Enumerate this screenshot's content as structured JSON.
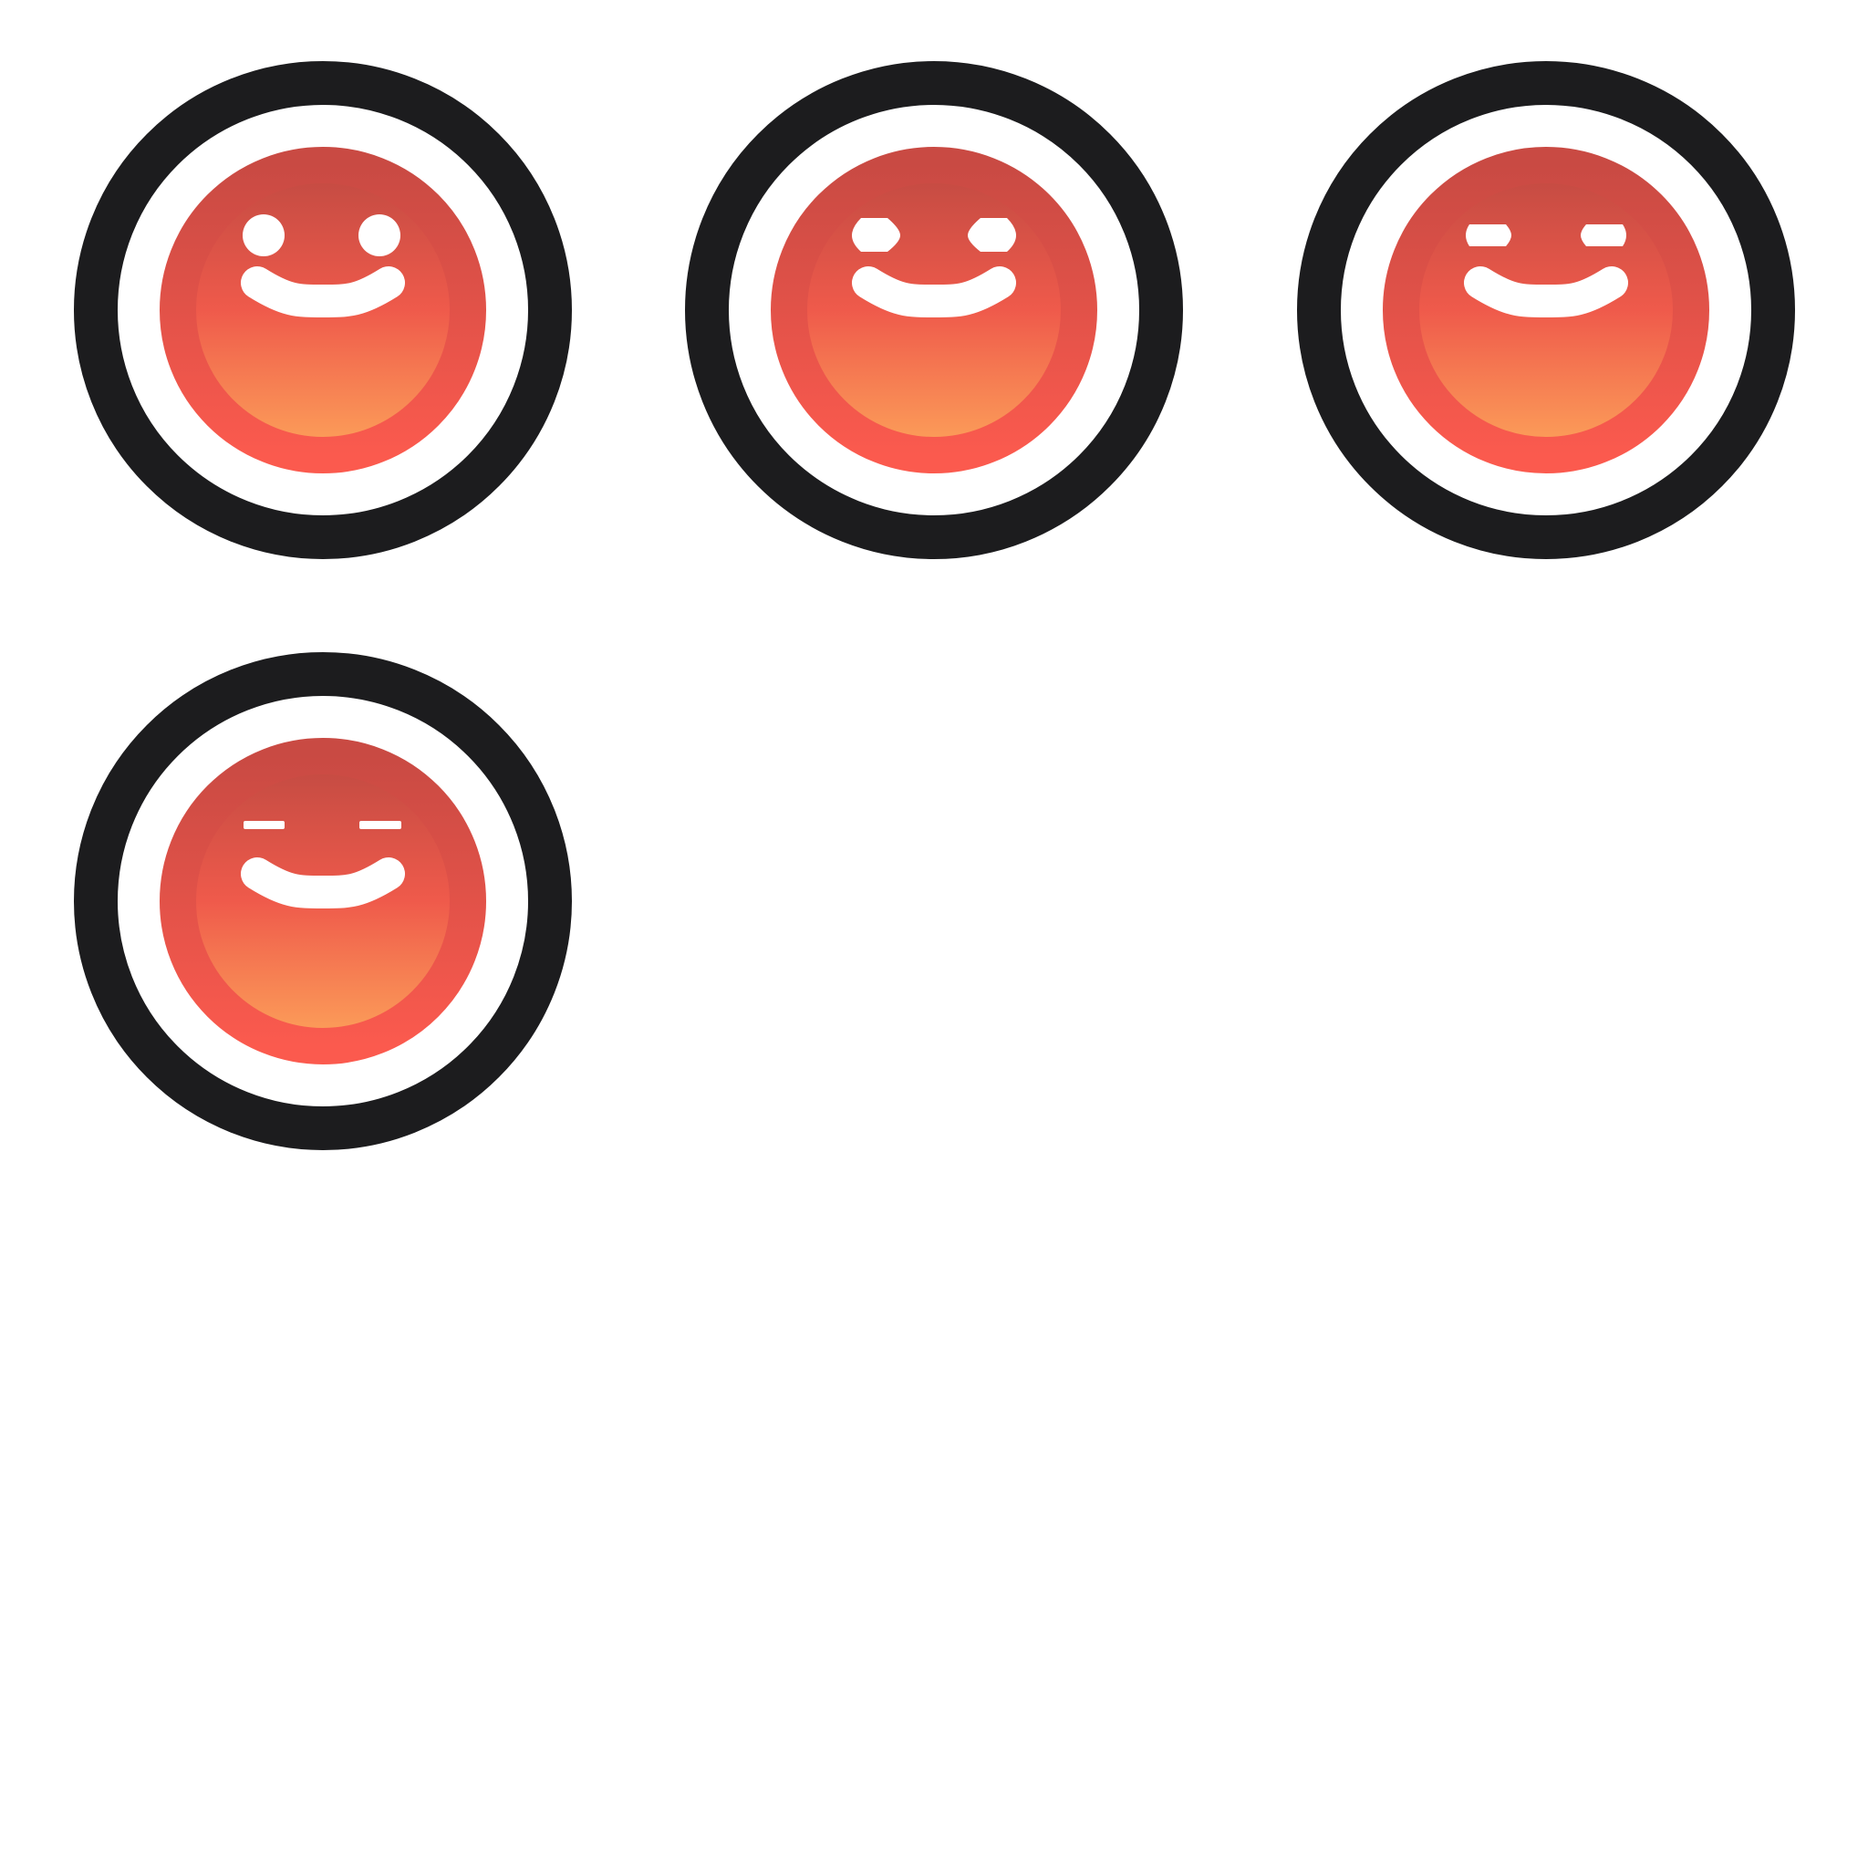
{
  "colors": {
    "background": "#ffffff",
    "ring": "#1c1c1e",
    "gradient_top": "#c14a42",
    "gradient_mid": "#ef5a4b",
    "gradient_bottom": "#fda35a",
    "face_border_top": "#c94a43",
    "face_border_bottom": "#fb5a4e",
    "features": "#ffffff"
  },
  "icons": [
    {
      "name": "smiley-eyes-open-icon",
      "eye_openness": 1.0
    },
    {
      "name": "smiley-eyes-narrowing-icon",
      "eye_openness": 0.75
    },
    {
      "name": "smiley-eyes-squinting-icon",
      "eye_openness": 0.5
    },
    {
      "name": "smiley-eyes-closed-icon",
      "eye_openness": 0.17
    }
  ]
}
